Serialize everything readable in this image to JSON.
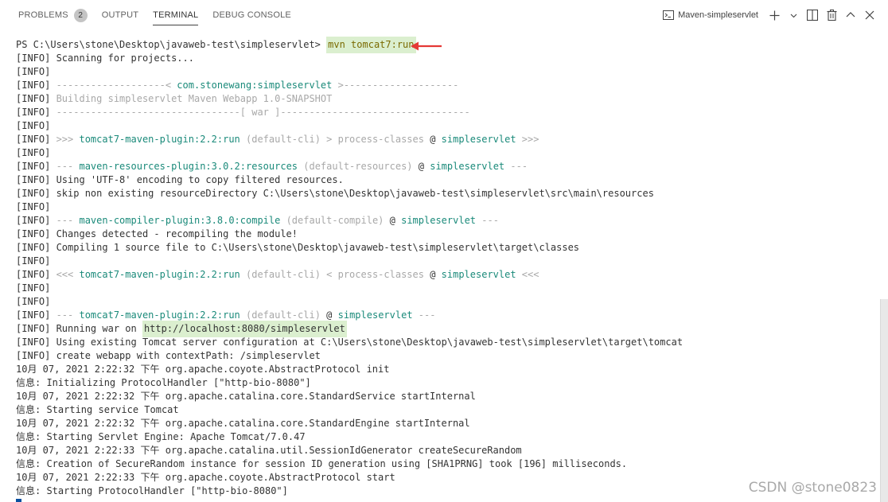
{
  "header": {
    "tabs": [
      {
        "label": "PROBLEMS",
        "badge": "2"
      },
      {
        "label": "OUTPUT"
      },
      {
        "label": "TERMINAL"
      },
      {
        "label": "DEBUG CONSOLE"
      }
    ],
    "terminal_name": "Maven-simpleservlet"
  },
  "terminal": {
    "lines": [
      [
        {
          "t": "PS C:\\Users\\stone\\Desktop\\javaweb-test\\simpleservlet> "
        },
        {
          "t": "mvn tomcat7:run",
          "c": "y",
          "hl": true
        }
      ],
      [
        {
          "t": "[INFO] Scanning for projects..."
        }
      ],
      [
        {
          "t": "[INFO]"
        }
      ],
      [
        {
          "t": "[INFO] "
        },
        {
          "t": "-------------------< ",
          "c": "d"
        },
        {
          "t": "com.stonewang:simpleservlet",
          "c": "g"
        },
        {
          "t": " >--------------------",
          "c": "d"
        }
      ],
      [
        {
          "t": "[INFO] "
        },
        {
          "t": "Building simpleservlet Maven Webapp 1.0-SNAPSHOT",
          "c": "d"
        }
      ],
      [
        {
          "t": "[INFO] "
        },
        {
          "t": "--------------------------------[ war ]---------------------------------",
          "c": "d"
        }
      ],
      [
        {
          "t": "[INFO]"
        }
      ],
      [
        {
          "t": "[INFO] "
        },
        {
          "t": ">>> ",
          "c": "d"
        },
        {
          "t": "tomcat7-maven-plugin:2.2:run",
          "c": "g"
        },
        {
          "t": " (default-cli) > process-classes",
          "c": "d"
        },
        {
          "t": " @ "
        },
        {
          "t": "simpleservlet",
          "c": "g"
        },
        {
          "t": " >>>",
          "c": "d"
        }
      ],
      [
        {
          "t": "[INFO]"
        }
      ],
      [
        {
          "t": "[INFO] "
        },
        {
          "t": "--- ",
          "c": "d"
        },
        {
          "t": "maven-resources-plugin:3.0.2:resources",
          "c": "g"
        },
        {
          "t": " (default-resources)",
          "c": "d"
        },
        {
          "t": " @ "
        },
        {
          "t": "simpleservlet",
          "c": "g"
        },
        {
          "t": " ---",
          "c": "d"
        }
      ],
      [
        {
          "t": "[INFO] Using 'UTF-8' encoding to copy filtered resources."
        }
      ],
      [
        {
          "t": "[INFO] skip non existing resourceDirectory C:\\Users\\stone\\Desktop\\javaweb-test\\simpleservlet\\src\\main\\resources"
        }
      ],
      [
        {
          "t": "[INFO]"
        }
      ],
      [
        {
          "t": "[INFO] "
        },
        {
          "t": "--- ",
          "c": "d"
        },
        {
          "t": "maven-compiler-plugin:3.8.0:compile",
          "c": "g"
        },
        {
          "t": " (default-compile)",
          "c": "d"
        },
        {
          "t": " @ "
        },
        {
          "t": "simpleservlet",
          "c": "g"
        },
        {
          "t": " ---",
          "c": "d"
        }
      ],
      [
        {
          "t": "[INFO] Changes detected - recompiling the module!"
        }
      ],
      [
        {
          "t": "[INFO] Compiling 1 source file to C:\\Users\\stone\\Desktop\\javaweb-test\\simpleservlet\\target\\classes"
        }
      ],
      [
        {
          "t": "[INFO]"
        }
      ],
      [
        {
          "t": "[INFO] "
        },
        {
          "t": "<<< ",
          "c": "d"
        },
        {
          "t": "tomcat7-maven-plugin:2.2:run",
          "c": "g"
        },
        {
          "t": " (default-cli) < process-classes",
          "c": "d"
        },
        {
          "t": " @ "
        },
        {
          "t": "simpleservlet",
          "c": "g"
        },
        {
          "t": " <<<",
          "c": "d"
        }
      ],
      [
        {
          "t": "[INFO]"
        }
      ],
      [
        {
          "t": "[INFO]"
        }
      ],
      [
        {
          "t": "[INFO] "
        },
        {
          "t": "--- ",
          "c": "d"
        },
        {
          "t": "tomcat7-maven-plugin:2.2:run",
          "c": "g"
        },
        {
          "t": " (default-cli)",
          "c": "d"
        },
        {
          "t": " @ "
        },
        {
          "t": "simpleservlet",
          "c": "g"
        },
        {
          "t": " ---",
          "c": "d"
        }
      ],
      [
        {
          "t": "[INFO] Running war on "
        },
        {
          "t": "http://localhost:8080/simpleservlet",
          "hl": true
        }
      ],
      [
        {
          "t": "[INFO] Using existing Tomcat server configuration at C:\\Users\\stone\\Desktop\\javaweb-test\\simpleservlet\\target\\tomcat"
        }
      ],
      [
        {
          "t": "[INFO] create webapp with contextPath: /simpleservlet"
        }
      ],
      [
        {
          "t": "10月 07, 2021 2:22:32 下午 org.apache.coyote.AbstractProtocol init"
        }
      ],
      [
        {
          "t": "信息: Initializing ProtocolHandler [\"http-bio-8080\"]"
        }
      ],
      [
        {
          "t": "10月 07, 2021 2:22:32 下午 org.apache.catalina.core.StandardService startInternal"
        }
      ],
      [
        {
          "t": "信息: Starting service Tomcat"
        }
      ],
      [
        {
          "t": "10月 07, 2021 2:22:32 下午 org.apache.catalina.core.StandardEngine startInternal"
        }
      ],
      [
        {
          "t": "信息: Starting Servlet Engine: Apache Tomcat/7.0.47"
        }
      ],
      [
        {
          "t": "10月 07, 2021 2:22:33 下午 org.apache.catalina.util.SessionIdGenerator createSecureRandom"
        }
      ],
      [
        {
          "t": "信息: Creation of SecureRandom instance for session ID generation using [SHA1PRNG] took [196] milliseconds."
        }
      ],
      [
        {
          "t": "10月 07, 2021 2:22:33 下午 org.apache.coyote.AbstractProtocol start"
        }
      ],
      [
        {
          "t": "信息: Starting ProtocolHandler [\"http-bio-8080\"]"
        }
      ]
    ]
  },
  "colors": {
    "accent_arrow": "#e53935",
    "highlight_bg": "#dbefcf",
    "plugin_text": "#1a8a7a",
    "muted_text": "#a8a8a8",
    "command_text": "#7a6a00"
  },
  "icons": [
    "terminal-icon",
    "plus-icon",
    "chevron-down-icon",
    "split-icon",
    "trash-icon",
    "chevron-up-icon",
    "close-icon",
    "arrow-icon"
  ],
  "watermark": "CSDN @stone0823"
}
